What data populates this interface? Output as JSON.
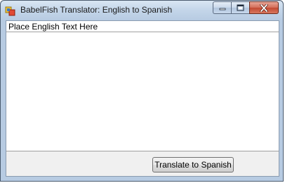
{
  "window": {
    "title": "BabelFish Translator: English to Spanish",
    "icon": "app-icon"
  },
  "caption_buttons": {
    "minimize_icon": "minimize-icon",
    "maximize_icon": "maximize-icon",
    "close_icon": "close-icon"
  },
  "input": {
    "text": "Place English Text Here"
  },
  "actions": {
    "translate_label": "Translate to Spanish"
  },
  "colors": {
    "title_bar": "#c3d5e9",
    "close_button": "#c24a32",
    "client_bg": "#f0f0f0"
  }
}
